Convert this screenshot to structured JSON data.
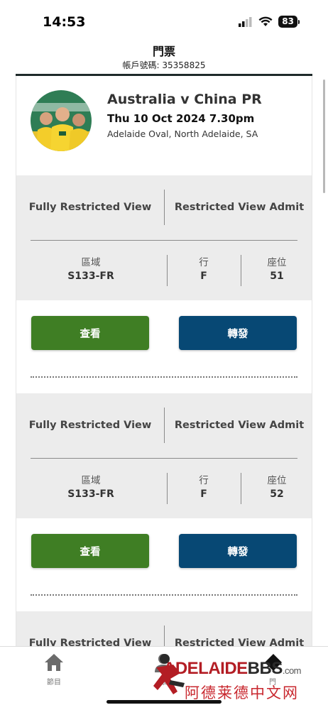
{
  "status_bar": {
    "time": "14:53",
    "battery": "83"
  },
  "header": {
    "title": "門票",
    "account_label": "帳戶號碼: 35358825"
  },
  "event": {
    "title": "Australia v China PR",
    "date": "Thu 10 Oct 2024 7.30pm",
    "venue": "Adelaide Oval, North Adelaide, SA"
  },
  "seat_labels": {
    "section": "區域",
    "row": "行",
    "seat": "座位"
  },
  "buttons": {
    "view": "查看",
    "forward": "轉發"
  },
  "tickets": [
    {
      "type_left": "Fully Restricted View",
      "type_right": "Restricted View Admit",
      "section": "S133-FR",
      "row": "F",
      "seat": "51"
    },
    {
      "type_left": "Fully Restricted View",
      "type_right": "Restricted View Admit",
      "section": "S133-FR",
      "row": "F",
      "seat": "52"
    },
    {
      "type_left": "Fully Restricted View",
      "type_right": "Restricted View Admit"
    }
  ],
  "tabbar": {
    "items": [
      {
        "label": "節目",
        "icon": "home-icon"
      },
      {
        "label": "帳",
        "icon": "user-icon"
      },
      {
        "label": "門",
        "icon": "ticket-icon"
      }
    ]
  },
  "watermark": {
    "brand_red": "ADELAIDE",
    "brand_dark": "BBS",
    "suffix": ".com",
    "chinese": "阿德莱德中文网"
  },
  "colors": {
    "view_button": "#3f7e24",
    "forward_button": "#074874",
    "accent_red": "#b31d24"
  }
}
